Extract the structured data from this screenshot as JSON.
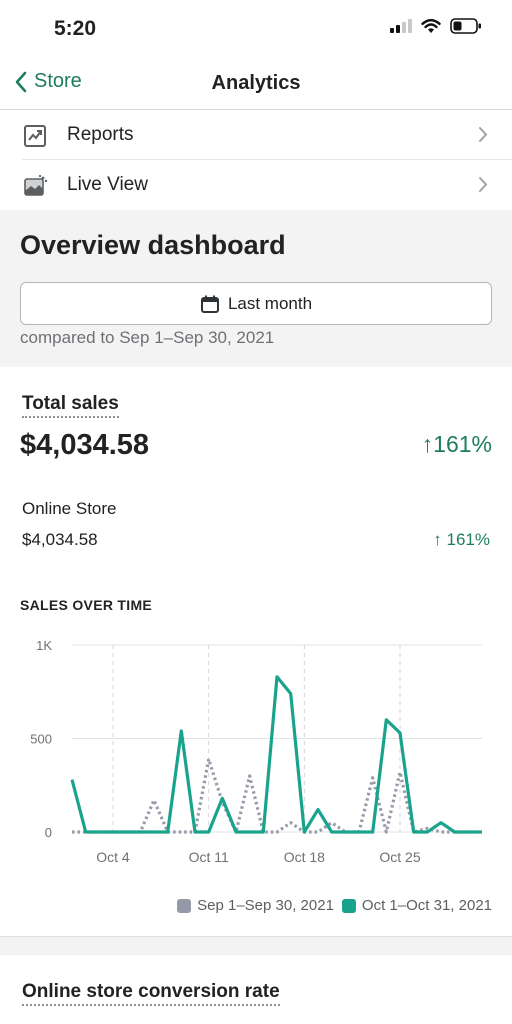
{
  "status_bar": {
    "time": "5:20"
  },
  "nav": {
    "back_label": "Store",
    "title": "Analytics"
  },
  "menu": [
    {
      "label": "Reports",
      "icon": "reports-icon"
    },
    {
      "label": "Live View",
      "icon": "live-view-icon"
    }
  ],
  "overview": {
    "title": "Overview dashboard",
    "date_button": "Last month",
    "compared_text": "compared to Sep 1–Sep 30, 2021"
  },
  "total_sales": {
    "label": "Total sales",
    "value": "$4,034.58",
    "change": "161%",
    "channel_label": "Online Store",
    "channel_value": "$4,034.58",
    "channel_change": "161%"
  },
  "sales_over_time": {
    "title": "SALES OVER TIME"
  },
  "colors": {
    "accent": "#1e7d5a",
    "current": "#1aa38c",
    "previous": "#949aa8"
  },
  "chart_data": {
    "type": "line",
    "title": "SALES OVER TIME",
    "y_ticks": [
      "1K",
      "500",
      "0"
    ],
    "ylim": [
      0,
      1000
    ],
    "x_tick_labels": [
      "Oct 4",
      "Oct 11",
      "Oct 18",
      "Oct 25"
    ],
    "x_tick_days": [
      4,
      11,
      18,
      25
    ],
    "series": [
      {
        "name": "Oct 1–Oct 31, 2021",
        "style": "solid",
        "x": [
          1,
          2,
          3,
          4,
          5,
          6,
          7,
          8,
          9,
          10,
          11,
          12,
          13,
          14,
          15,
          16,
          17,
          18,
          19,
          20,
          21,
          22,
          23,
          24,
          25,
          26,
          27,
          28,
          29,
          30,
          31
        ],
        "values": [
          280,
          0,
          0,
          0,
          0,
          0,
          0,
          0,
          540,
          0,
          0,
          180,
          0,
          0,
          0,
          830,
          740,
          0,
          120,
          0,
          0,
          0,
          0,
          600,
          530,
          0,
          0,
          50,
          0,
          0,
          0
        ]
      },
      {
        "name": "Sep 1–Sep 30, 2021",
        "style": "dotted",
        "x": [
          1,
          2,
          3,
          4,
          5,
          6,
          7,
          8,
          9,
          10,
          11,
          12,
          13,
          14,
          15,
          16,
          17,
          18,
          19,
          20,
          21,
          22,
          23,
          24,
          25,
          26,
          27,
          28,
          29,
          30
        ],
        "values": [
          0,
          0,
          0,
          0,
          0,
          0,
          170,
          0,
          0,
          0,
          390,
          160,
          0,
          300,
          0,
          0,
          50,
          0,
          0,
          50,
          0,
          0,
          290,
          0,
          320,
          0,
          20,
          0,
          0,
          0
        ]
      }
    ],
    "legend": [
      "Sep 1–Sep 30, 2021",
      "Oct 1–Oct 31, 2021"
    ],
    "grid": true,
    "legend_position": "bottom-right"
  },
  "conversion": {
    "label": "Online store conversion rate"
  }
}
